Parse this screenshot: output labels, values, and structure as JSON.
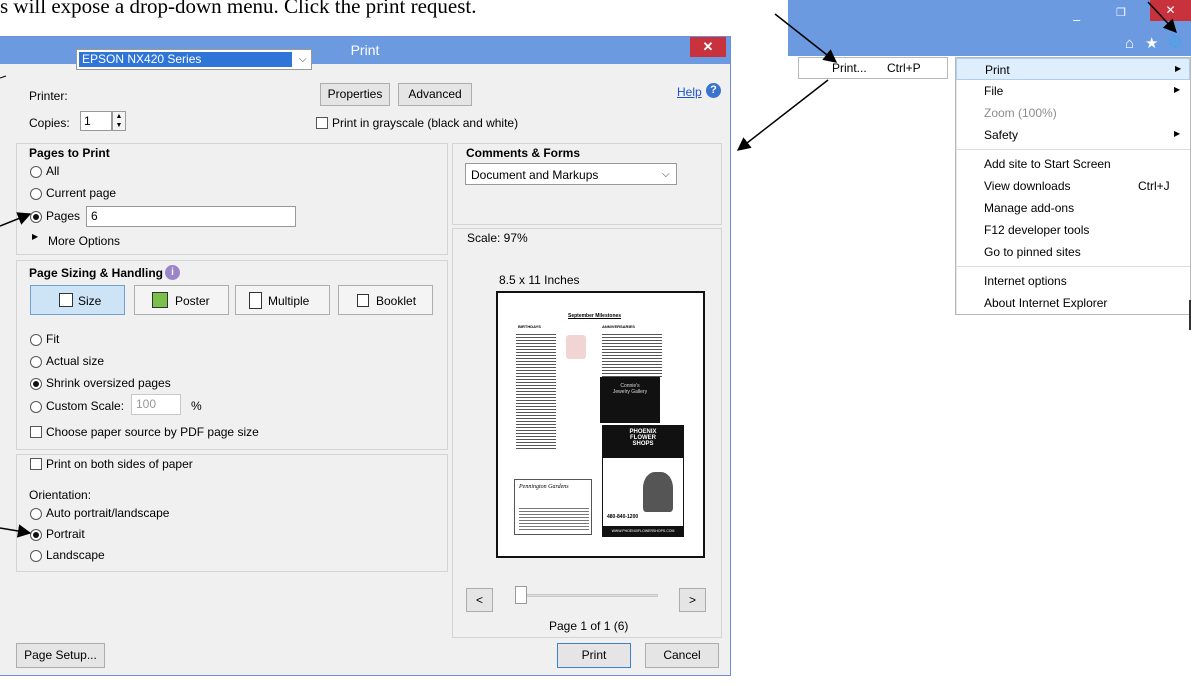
{
  "caption": "s will expose a drop-down menu. Click the print request.",
  "dialog": {
    "title": "Print",
    "close_glyph": "✕",
    "printer_label": "Printer:",
    "printer_value": "EPSON NX420 Series",
    "properties": "Properties",
    "advanced": "Advanced",
    "help": "Help",
    "copies_label": "Copies:",
    "copies_value": "1",
    "grayscale": "Print in grayscale (black and white)",
    "pages_to_print": {
      "heading": "Pages to Print",
      "all": "All",
      "current": "Current page",
      "pages": "Pages",
      "pages_value": "6",
      "more": "More Options"
    },
    "sizing": {
      "heading": "Page Sizing & Handling",
      "tabs": [
        "Size",
        "Poster",
        "Multiple",
        "Booklet"
      ],
      "fit": "Fit",
      "actual": "Actual size",
      "shrink": "Shrink oversized pages",
      "custom": "Custom Scale:",
      "custom_value": "100",
      "percent": "%",
      "paper_source": "Choose paper source by PDF page size"
    },
    "both_sides": "Print on both sides of paper",
    "orientation": {
      "heading": "Orientation:",
      "auto": "Auto portrait/landscape",
      "portrait": "Portrait",
      "landscape": "Landscape"
    },
    "comments": {
      "heading": "Comments & Forms",
      "value": "Document and Markups"
    },
    "preview": {
      "scale": "Scale: 97%",
      "paper": "8.5 x 11 Inches",
      "page_info": "Page 1 of 1 (6)",
      "prev": "<",
      "next": ">"
    },
    "doc": {
      "title": "September Milestones",
      "col1": "BIRTHDAYS",
      "col2": "ANNIVERSARIES",
      "ad1_a": "Connie's",
      "ad1_b": "Jewelry Gallery",
      "ad2_a": "PHOENIX",
      "ad2_b": "FLOWER",
      "ad2_c": "SHOPS",
      "ad2_phone": "480-840-1200",
      "ad2_url": "WWW.PHOENIXFLOWERSHOPS.COM",
      "ad3": "Pennington Gardens"
    },
    "page_setup": "Page Setup...",
    "print": "Print",
    "cancel": "Cancel"
  },
  "ie": {
    "controls": [
      "–",
      "❐",
      "✕"
    ],
    "print_submenu": {
      "label": "Print...",
      "shortcut": "Ctrl+P"
    },
    "menu": [
      {
        "label": "Print",
        "arrow": "▶",
        "highlight": true
      },
      {
        "label": "File",
        "arrow": "▶"
      },
      {
        "label": "Zoom (100%)",
        "disabled": true
      },
      {
        "label": "Safety",
        "arrow": "▶"
      },
      {
        "label": "Add site to Start Screen"
      },
      {
        "label": "View downloads",
        "shortcut": "Ctrl+J"
      },
      {
        "label": "Manage add-ons"
      },
      {
        "label": "F12 developer tools"
      },
      {
        "label": "Go to pinned sites"
      },
      {
        "label": "Internet options"
      },
      {
        "label": "About Internet Explorer"
      }
    ]
  },
  "colors": {
    "accent": "#6b9ae0",
    "selection": "#2f75d8",
    "close": "#c7323d",
    "menu_highlight": "#dfeefc"
  }
}
